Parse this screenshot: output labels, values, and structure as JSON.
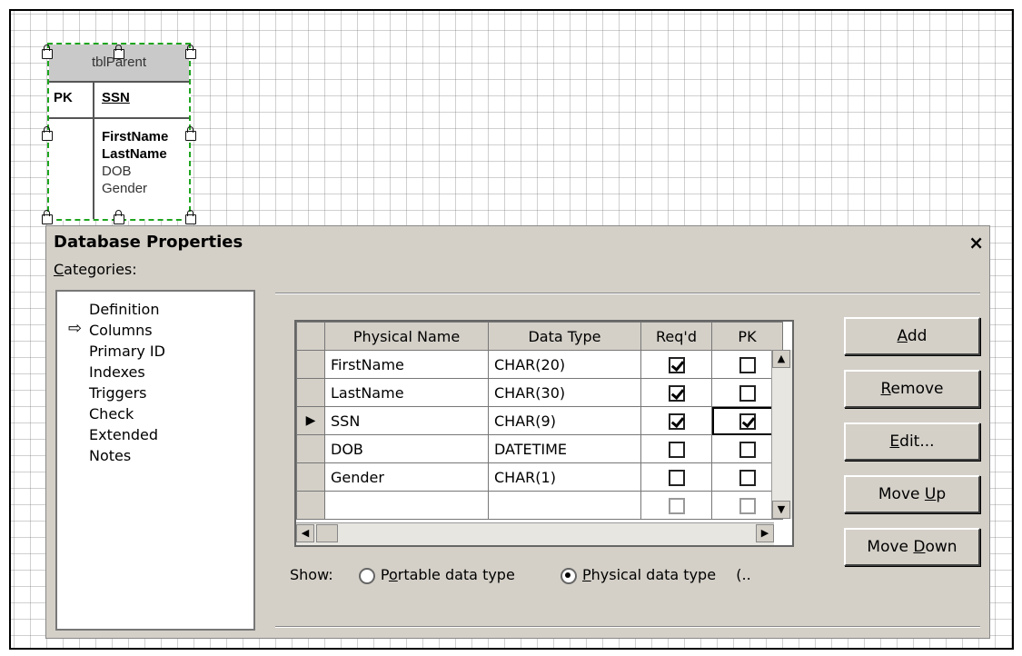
{
  "entity": {
    "title": "tblParent",
    "pk_label": "PK",
    "pk_field": "SSN",
    "attributes_bold": [
      "FirstName",
      "LastName"
    ],
    "attributes": [
      "DOB",
      "Gender"
    ]
  },
  "dialog": {
    "title": "Database Properties",
    "close": "×",
    "categories_label": "Categories:",
    "categories": [
      "Definition",
      "Columns",
      "Primary ID",
      "Indexes",
      "Triggers",
      "Check",
      "Extended",
      "Notes"
    ],
    "selected_category": "Columns",
    "table": {
      "headers": [
        "Physical Name",
        "Data Type",
        "Req'd",
        "PK"
      ],
      "rows": [
        {
          "name": "FirstName",
          "type": "CHAR(20)",
          "reqd": true,
          "pk": false
        },
        {
          "name": "LastName",
          "type": "CHAR(30)",
          "reqd": true,
          "pk": false
        },
        {
          "name": "SSN",
          "type": "CHAR(9)",
          "reqd": true,
          "pk": true,
          "current": true
        },
        {
          "name": "DOB",
          "type": "DATETIME",
          "reqd": false,
          "pk": false
        },
        {
          "name": "Gender",
          "type": "CHAR(1)",
          "reqd": false,
          "pk": false
        }
      ]
    },
    "buttons": [
      "Add",
      "Remove",
      "Edit...",
      "Move Up",
      "Move Down"
    ],
    "show": {
      "label": "Show:",
      "options": [
        "Portable data type",
        "Physical data type"
      ],
      "selected": "Physical data type",
      "trailing": "(.."
    }
  }
}
